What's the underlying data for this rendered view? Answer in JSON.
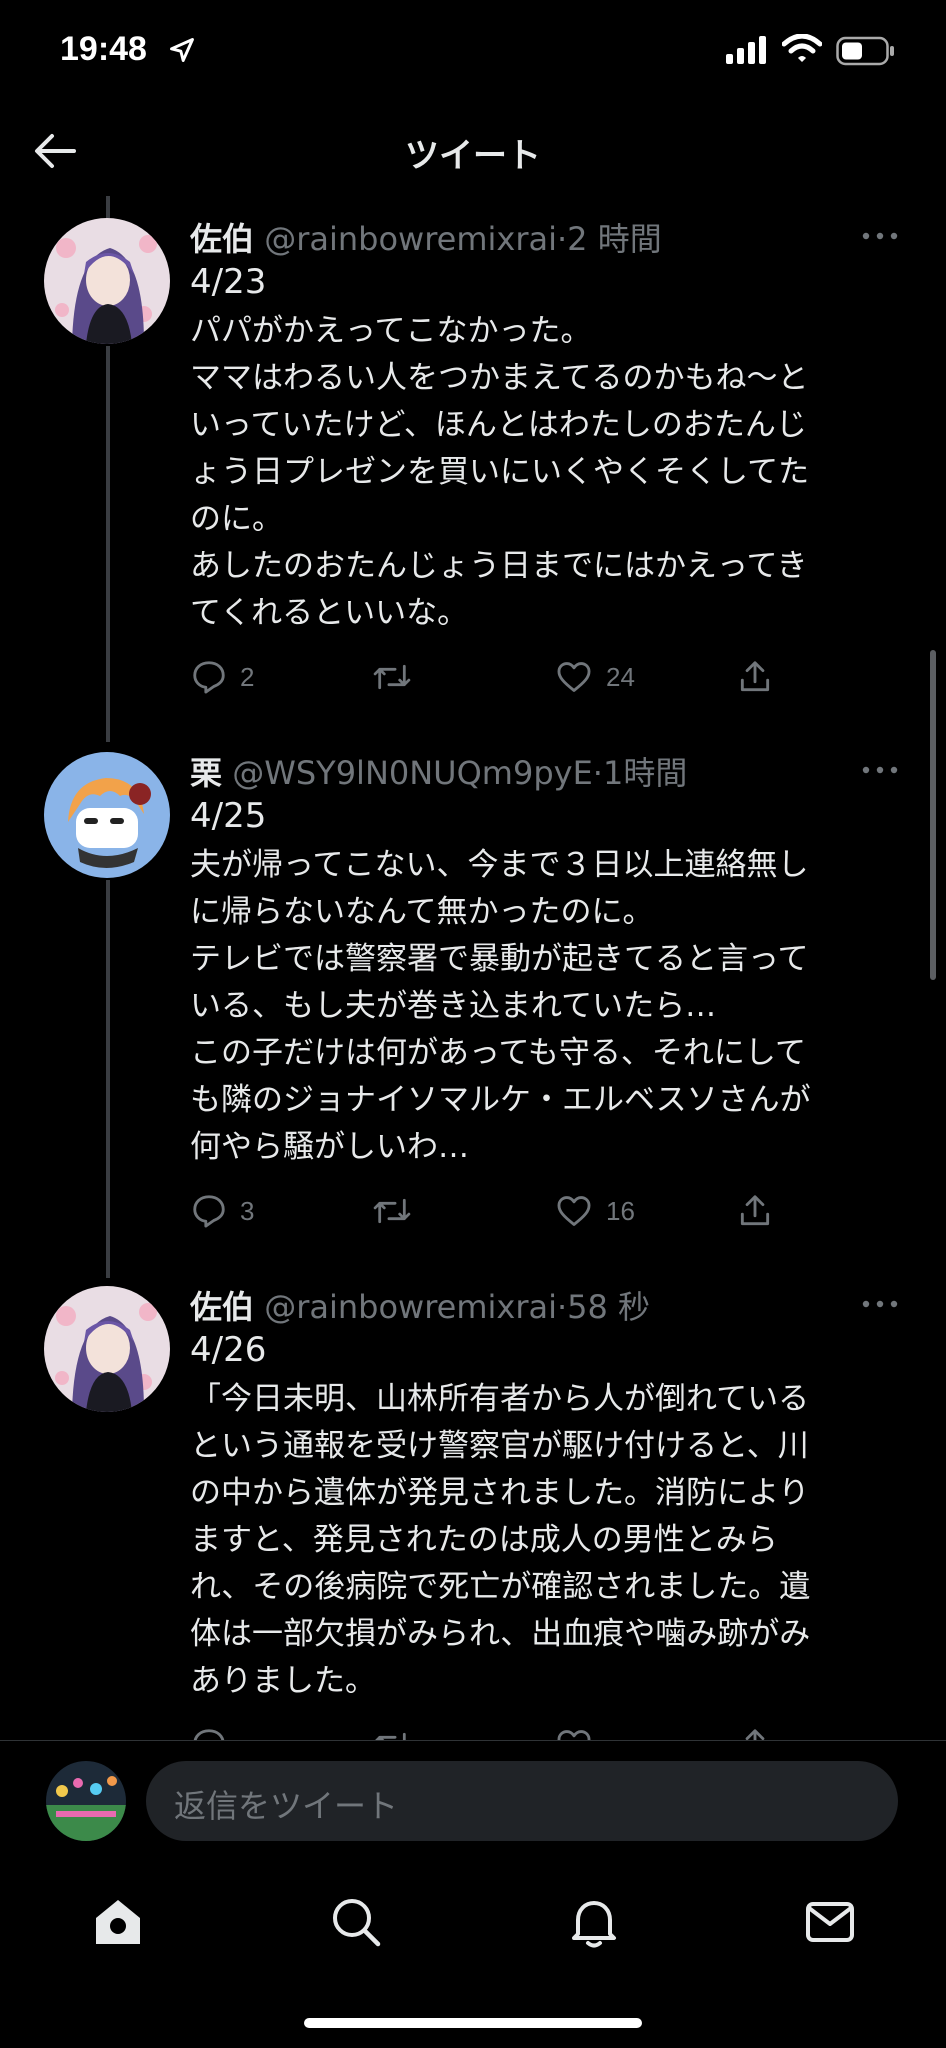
{
  "status_bar": {
    "time": "19:48"
  },
  "header": {
    "title": "ツイート"
  },
  "tweets": [
    {
      "name": "佐伯",
      "handle": "@rainbowremixrai",
      "age": "2 時間",
      "date": "4/23",
      "lines": [
        "パパがかえってこなかった。",
        "ママはわるい人をつかまえてるのかもね〜と",
        "いっていたけど、ほんとはわたしのおたんじ",
        "ょう日プレゼンを買いにいくやくそくしてた",
        "のに。",
        "あしたのおたんじょう日までにはかえってき",
        "てくれるといいな。"
      ],
      "replies": "2",
      "retweets": "",
      "likes": "24"
    },
    {
      "name": "栗",
      "handle": "@WSY9lN0NUQm9pyE",
      "age": "1時間",
      "date": "4/25",
      "lines": [
        "夫が帰ってこない、今まで３日以上連絡無し",
        "に帰らないなんて無かったのに。",
        "テレビでは警察署で暴動が起きてると言って",
        "いる、もし夫が巻き込まれていたら…",
        "この子だけは何があっても守る、それにして",
        "も隣のジョナイソマルケ・エルベスソさんが",
        "何やら騒がしいわ…"
      ],
      "replies": "3",
      "retweets": "",
      "likes": "16"
    },
    {
      "name": "佐伯",
      "handle": "@rainbowremixrai",
      "age": "58 秒",
      "date": "4/26",
      "lines": [
        "「今日未明、山林所有者から人が倒れている",
        "という通報を受け警察官が駆け付けると、川",
        "の中から遺体が発見されました。消防により",
        "ますと、発見されたのは成人の男性とみら",
        "れ、その後病院で死亡が確認されました。遺",
        "体は一部欠損がみられ、出血痕や噛み跡がみ",
        "ありました。"
      ],
      "replies": "",
      "retweets": "",
      "likes": ""
    }
  ],
  "composer": {
    "placeholder": "返信をツイート"
  },
  "colors": {
    "background": "#000000",
    "text": "#e7e9ea",
    "muted": "#71767b",
    "divider": "#2f3336"
  },
  "icons": [
    "back-arrow-icon",
    "more-icon",
    "reply-icon",
    "retweet-icon",
    "like-icon",
    "share-icon",
    "home-icon",
    "search-icon",
    "notifications-icon",
    "messages-icon"
  ]
}
